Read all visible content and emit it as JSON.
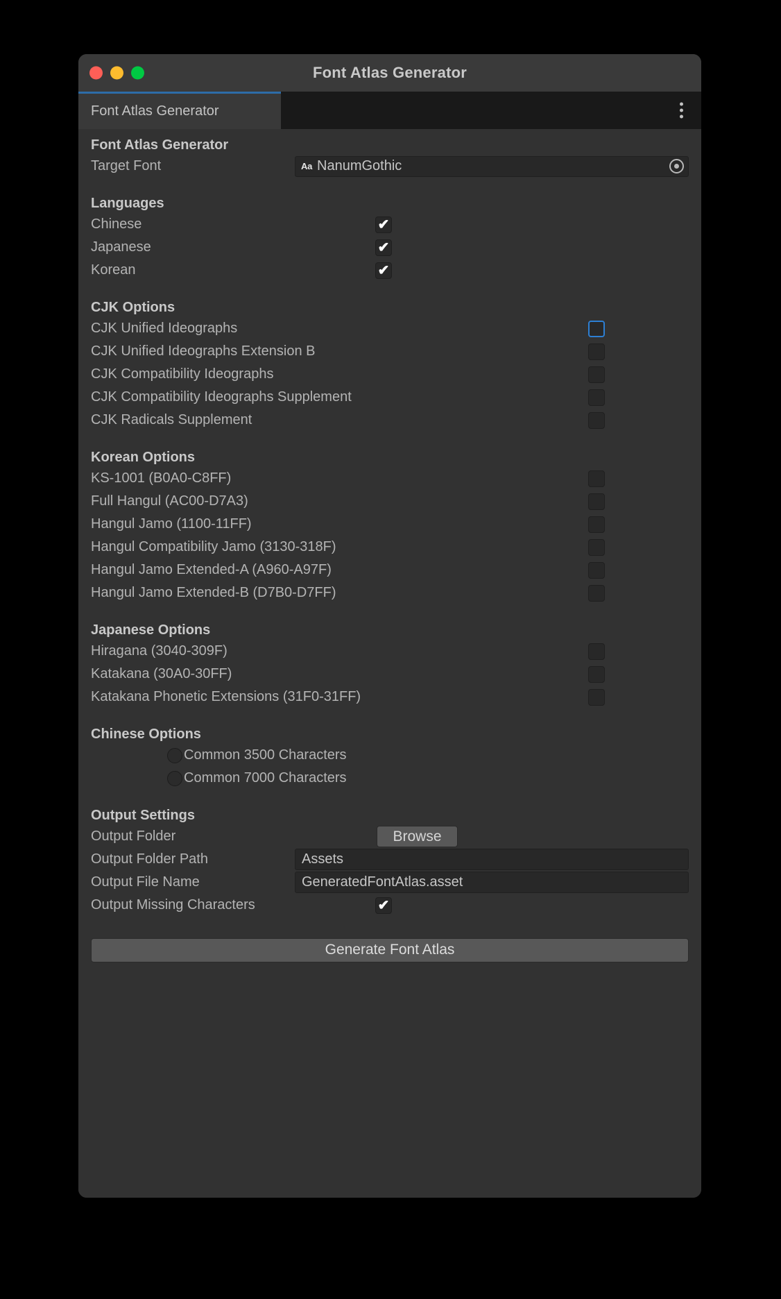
{
  "window": {
    "title": "Font Atlas Generator",
    "traffic_lights": [
      "close-button",
      "minimize-button",
      "zoom-button"
    ],
    "colors": {
      "close": "#ff5f57",
      "minimize": "#febc2e",
      "zoom": "#00c943",
      "tab_accent": "#2d6ca8",
      "focus_ring": "#2d7fd3",
      "window_bg": "#323232",
      "titlebar_bg": "#3a3a3a",
      "tabbar_bg": "#191919"
    }
  },
  "tabbar": {
    "active_tab": "Font Atlas Generator",
    "menu_icon": "kebab-menu-icon"
  },
  "main": {
    "header": "Font Atlas Generator",
    "target_font": {
      "label": "Target Font",
      "icon": "font-asset-icon",
      "icon_text": "Aa",
      "value": "NanumGothic",
      "picker_icon": "object-picker-icon"
    },
    "languages": {
      "header": "Languages",
      "items": [
        {
          "label": "Chinese",
          "checked": true
        },
        {
          "label": "Japanese",
          "checked": true
        },
        {
          "label": "Korean",
          "checked": true
        }
      ]
    },
    "cjk_options": {
      "header": "CJK Options",
      "items": [
        {
          "label": "CJK Unified Ideographs",
          "checked": false,
          "focused": true
        },
        {
          "label": "CJK Unified Ideographs Extension B",
          "checked": false,
          "focused": false
        },
        {
          "label": "CJK Compatibility Ideographs",
          "checked": false,
          "focused": false
        },
        {
          "label": "CJK Compatibility Ideographs Supplement",
          "checked": false,
          "focused": false
        },
        {
          "label": "CJK Radicals Supplement",
          "checked": false,
          "focused": false
        }
      ]
    },
    "korean_options": {
      "header": "Korean Options",
      "items": [
        {
          "label": "KS-1001 (B0A0-C8FF)",
          "checked": false
        },
        {
          "label": "Full Hangul (AC00-D7A3)",
          "checked": false
        },
        {
          "label": "Hangul Jamo (1100-11FF)",
          "checked": false
        },
        {
          "label": "Hangul Compatibility Jamo (3130-318F)",
          "checked": false
        },
        {
          "label": "Hangul Jamo Extended-A (A960-A97F)",
          "checked": false
        },
        {
          "label": "Hangul Jamo Extended-B (D7B0-D7FF)",
          "checked": false
        }
      ]
    },
    "japanese_options": {
      "header": "Japanese Options",
      "items": [
        {
          "label": "Hiragana (3040-309F)",
          "checked": false
        },
        {
          "label": "Katakana (30A0-30FF)",
          "checked": false
        },
        {
          "label": "Katakana Phonetic Extensions (31F0-31FF)",
          "checked": false
        }
      ]
    },
    "chinese_options": {
      "header": "Chinese Options",
      "items": [
        {
          "label": "Common 3500 Characters",
          "selected": false
        },
        {
          "label": "Common 7000 Characters",
          "selected": false
        }
      ]
    },
    "output_settings": {
      "header": "Output Settings",
      "output_folder_label": "Output Folder",
      "browse_label": "Browse",
      "output_folder_path_label": "Output Folder Path",
      "output_folder_path_value": "Assets",
      "output_file_name_label": "Output File Name",
      "output_file_name_value": "GeneratedFontAtlas.asset",
      "output_missing_label": "Output Missing Characters",
      "output_missing_checked": true
    },
    "generate_button": "Generate Font Atlas",
    "tick_glyph": "✔"
  }
}
